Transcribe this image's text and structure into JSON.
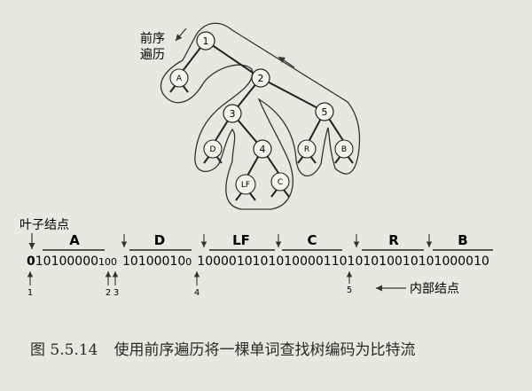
{
  "tree": {
    "traversal_label_line1": "前序",
    "traversal_label_line2": "遍历",
    "internal_nodes": [
      "1",
      "2",
      "3",
      "4",
      "5"
    ],
    "leaves": [
      "A",
      "D",
      "LF",
      "C",
      "R",
      "B"
    ]
  },
  "encoding": {
    "leaf_node_label": "叶子结点",
    "internal_node_label": "内部结点",
    "segment_labels": [
      "A",
      "D",
      "LF",
      "C",
      "R",
      "B"
    ],
    "bits": {
      "b1": "0",
      "a": "10100000",
      "b23": "100",
      "d": "10100010",
      "b4": "0",
      "lf": "100001010",
      "c": "10100001",
      "b5": "10",
      "r": "10101001",
      "b": "0101000010"
    },
    "positions": [
      "1",
      "2",
      "3",
      "4",
      "5"
    ]
  },
  "caption": {
    "number": "图 5.5.14",
    "text": "使用前序遍历将一棵单词查找树编码为比特流"
  }
}
